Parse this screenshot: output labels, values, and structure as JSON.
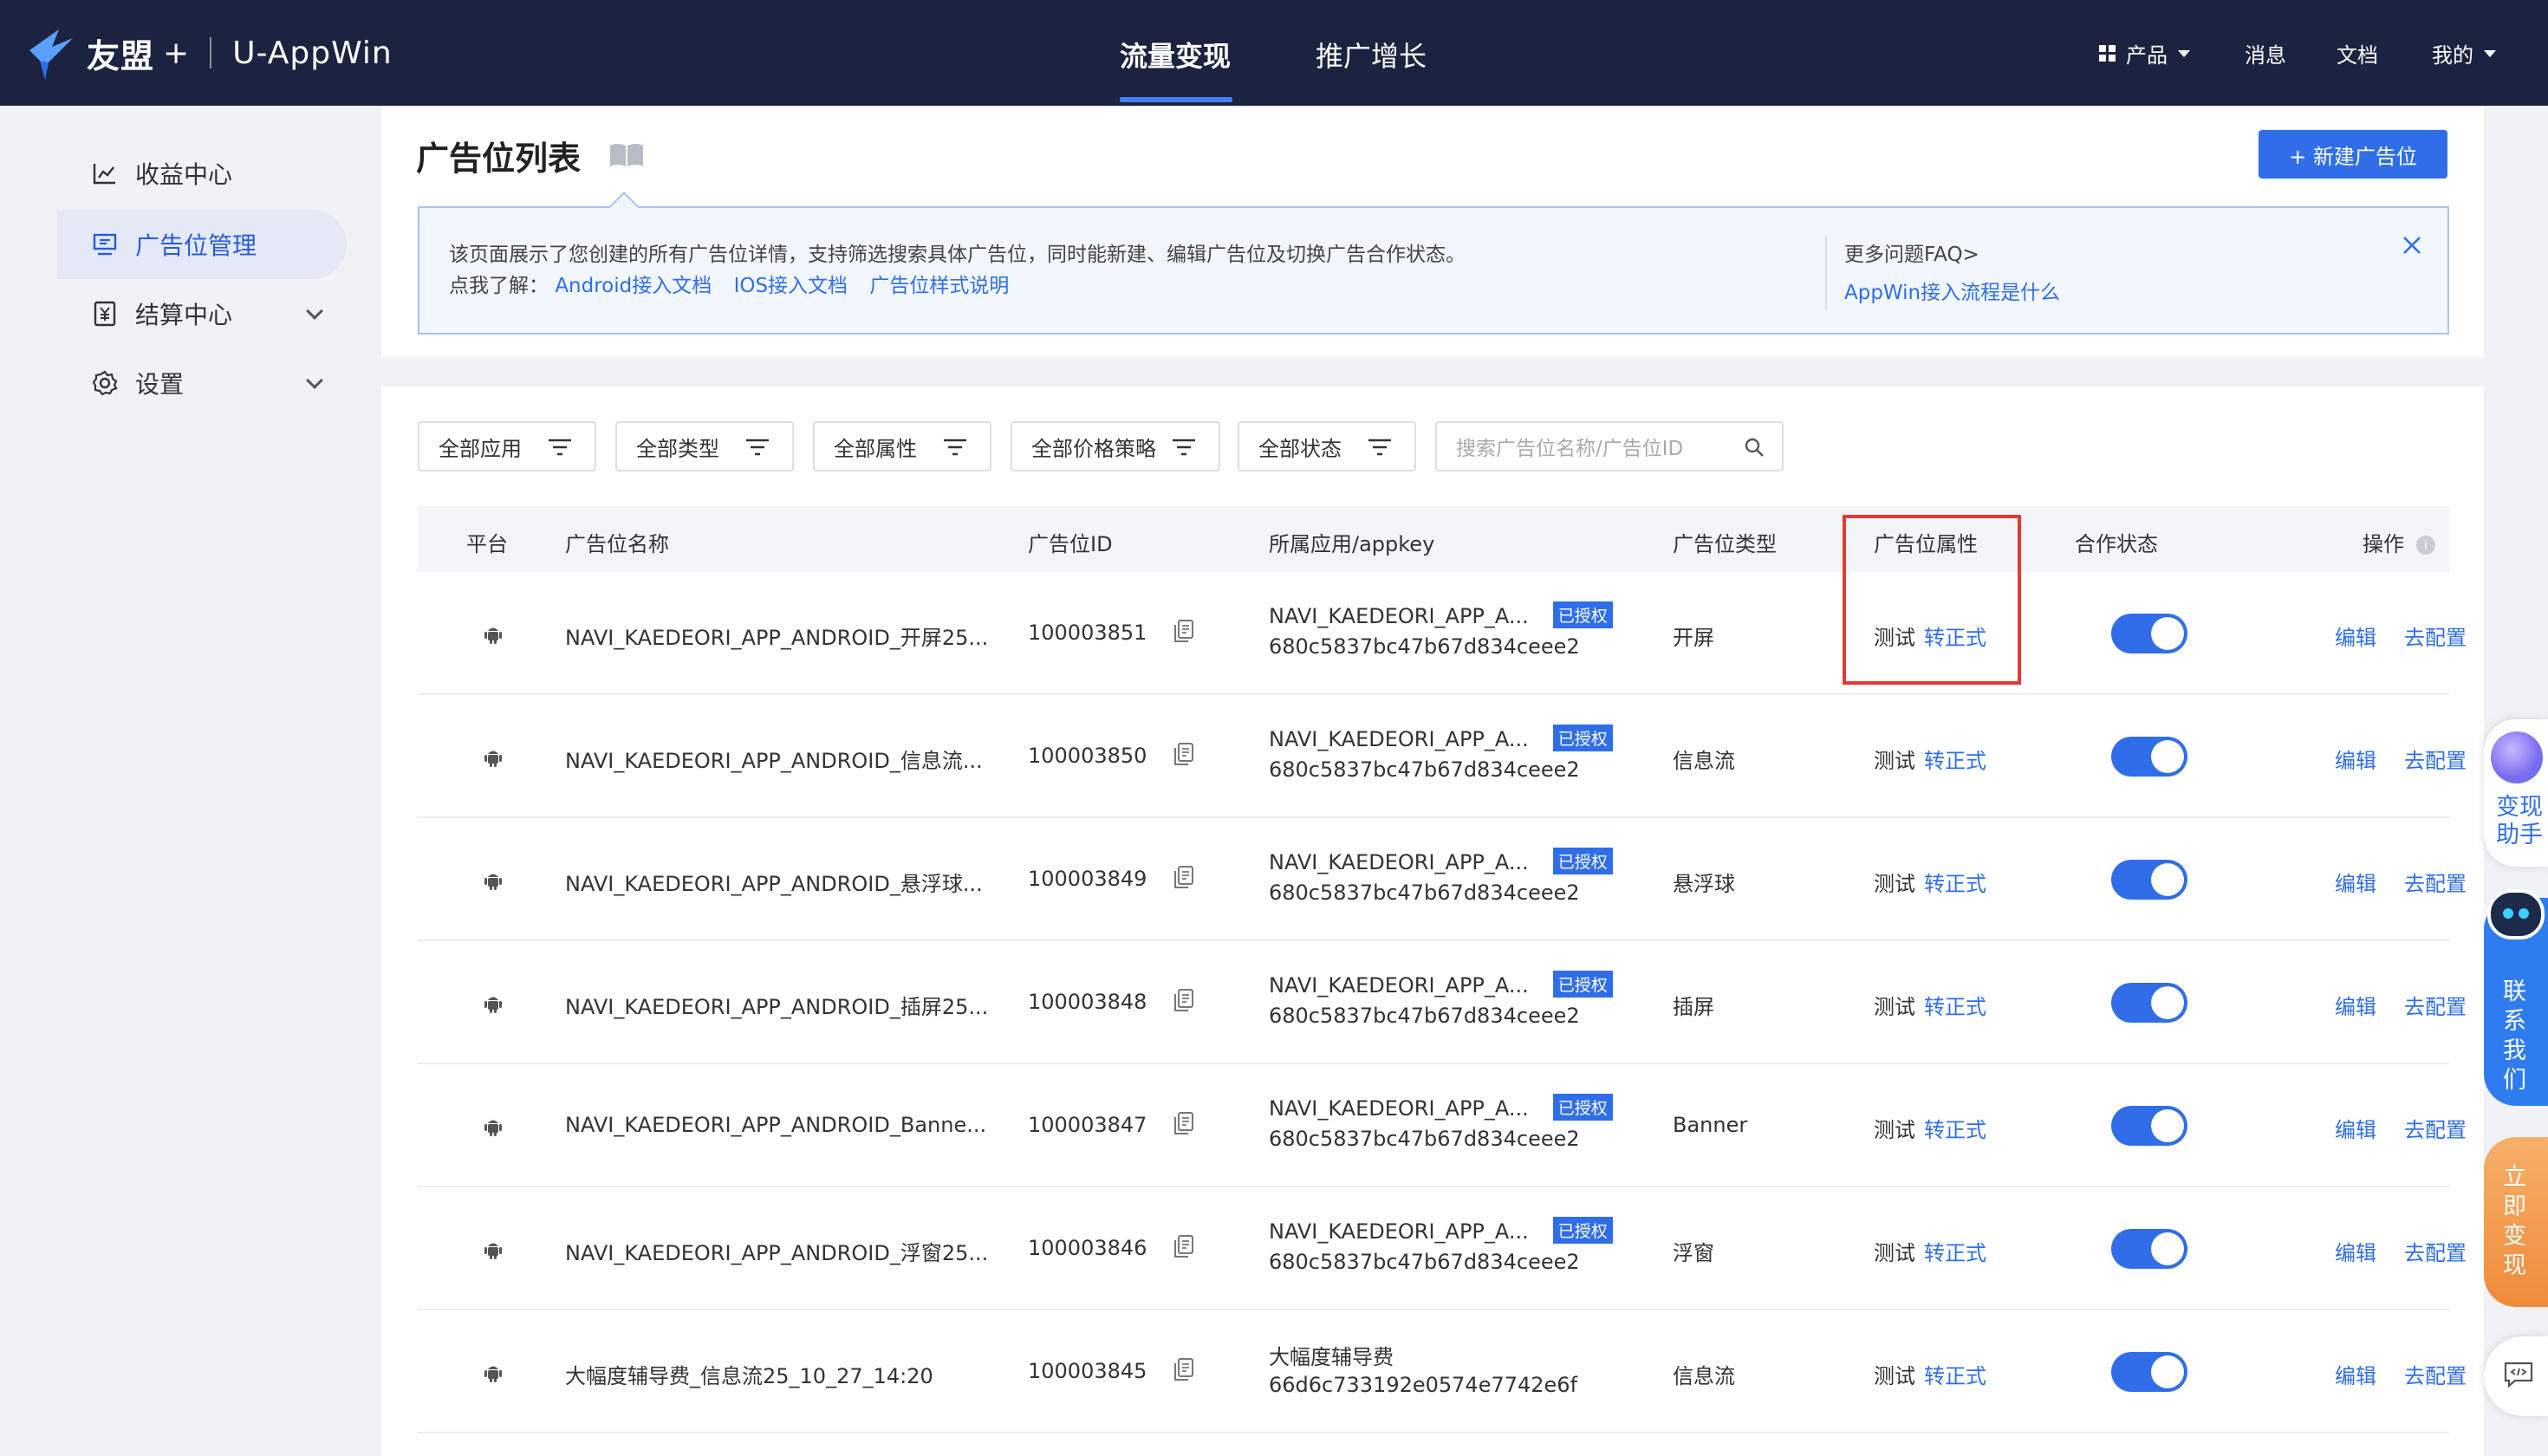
{
  "header": {
    "brand": "友盟",
    "brand_plus": "+",
    "product": "U-AppWin",
    "nav": [
      "流量变现",
      "推广增长"
    ],
    "active_nav": "流量变现",
    "right": {
      "products": "产品",
      "messages": "消息",
      "docs": "文档",
      "mine": "我的"
    }
  },
  "sidebar": {
    "items": [
      {
        "label": "收益中心",
        "icon": "line-chart-icon",
        "active": false,
        "expandable": false
      },
      {
        "label": "广告位管理",
        "icon": "monitor-icon",
        "active": true,
        "expandable": false
      },
      {
        "label": "结算中心",
        "icon": "yen-icon",
        "active": false,
        "expandable": true
      },
      {
        "label": "设置",
        "icon": "gear-icon",
        "active": false,
        "expandable": true
      }
    ]
  },
  "page": {
    "title": "广告位列表",
    "new_button": "+ 新建广告位",
    "info": {
      "line1": "该页面展示了您创建的所有广告位详情，支持筛选搜索具体广告位，同时能新建、编辑广告位及切换广告合作状态。",
      "line2_prefix": "点我了解：",
      "links": [
        "Android接入文档",
        "IOS接入文档",
        "广告位样式说明"
      ],
      "faq_title": "更多问题FAQ>",
      "faq_link": "AppWin接入流程是什么"
    }
  },
  "filters": {
    "app": "全部应用",
    "type": "全部类型",
    "attr": "全部属性",
    "price": "全部价格策略",
    "status": "全部状态",
    "search_placeholder": "搜索广告位名称/广告位ID"
  },
  "table": {
    "columns": {
      "platform": "平台",
      "name": "广告位名称",
      "id": "广告位ID",
      "app": "所属应用/appkey",
      "type": "广告位类型",
      "attr": "广告位属性",
      "status": "合作状态",
      "ops": "操作"
    },
    "badge_label": "已授权",
    "attr_test": "测试",
    "attr_switch": "转正式",
    "op_edit": "编辑",
    "op_config": "去配置",
    "rows": [
      {
        "name": "NAVI_KAEDEORI_APP_ANDROID_开屏25...",
        "id": "100003851",
        "app": "NAVI_KAEDEORI_APP_A...",
        "appkey": "680c5837bc47b67d834ceee2",
        "authorized": true,
        "type": "开屏",
        "enabled": true
      },
      {
        "name": "NAVI_KAEDEORI_APP_ANDROID_信息流...",
        "id": "100003850",
        "app": "NAVI_KAEDEORI_APP_A...",
        "appkey": "680c5837bc47b67d834ceee2",
        "authorized": true,
        "type": "信息流",
        "enabled": true
      },
      {
        "name": "NAVI_KAEDEORI_APP_ANDROID_悬浮球...",
        "id": "100003849",
        "app": "NAVI_KAEDEORI_APP_A...",
        "appkey": "680c5837bc47b67d834ceee2",
        "authorized": true,
        "type": "悬浮球",
        "enabled": true
      },
      {
        "name": "NAVI_KAEDEORI_APP_ANDROID_插屏25...",
        "id": "100003848",
        "app": "NAVI_KAEDEORI_APP_A...",
        "appkey": "680c5837bc47b67d834ceee2",
        "authorized": true,
        "type": "插屏",
        "enabled": true
      },
      {
        "name": "NAVI_KAEDEORI_APP_ANDROID_Banne...",
        "id": "100003847",
        "app": "NAVI_KAEDEORI_APP_A...",
        "appkey": "680c5837bc47b67d834ceee2",
        "authorized": true,
        "type": "Banner",
        "enabled": true
      },
      {
        "name": "NAVI_KAEDEORI_APP_ANDROID_浮窗25...",
        "id": "100003846",
        "app": "NAVI_KAEDEORI_APP_A...",
        "appkey": "680c5837bc47b67d834ceee2",
        "authorized": true,
        "type": "浮窗",
        "enabled": true
      },
      {
        "name": "大幅度辅导费_信息流25_10_27_14:20",
        "id": "100003845",
        "app": "大幅度辅导费",
        "appkey": "66d6c733192e0574e7742e6f",
        "authorized": false,
        "type": "信息流",
        "enabled": true
      }
    ]
  },
  "floating": {
    "assistant": "变现助手",
    "contact": [
      "联",
      "系",
      "我",
      "们"
    ],
    "monetize": [
      "立",
      "即",
      "变",
      "现"
    ]
  },
  "colors": {
    "header_bg": "#1b2340",
    "accent": "#2f6ee8",
    "highlight": "#e53935"
  }
}
